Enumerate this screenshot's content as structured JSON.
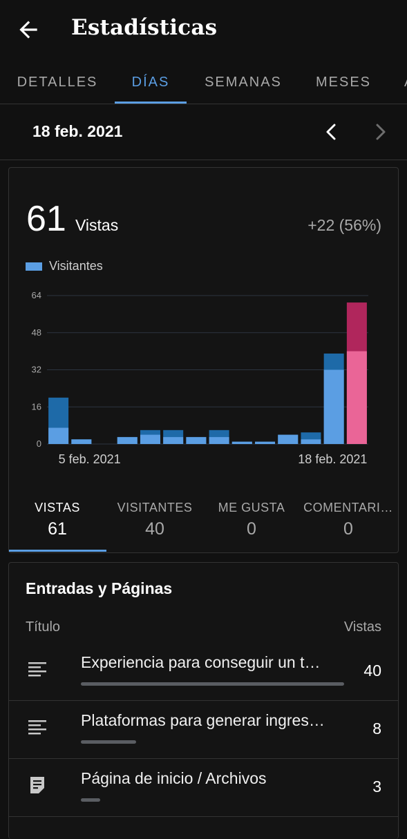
{
  "header": {
    "title": "Estadísticas",
    "back_icon": "arrow-back-icon"
  },
  "tabs": [
    {
      "label": "DETALLES",
      "active": false
    },
    {
      "label": "DÍAS",
      "active": true
    },
    {
      "label": "SEMANAS",
      "active": false
    },
    {
      "label": "MESES",
      "active": false
    },
    {
      "label": "A",
      "active": false
    }
  ],
  "date_nav": {
    "date": "18 feb. 2021"
  },
  "summary": {
    "count": "61",
    "label": "Vistas",
    "delta": "+22 (56%)",
    "legend": "Visitantes"
  },
  "chart_data": {
    "type": "bar",
    "x_labels": [
      "5 feb. 2021",
      "18 feb. 2021"
    ],
    "ylim": [
      0,
      64
    ],
    "yticks": [
      0,
      16,
      32,
      48,
      64
    ],
    "series": [
      {
        "name": "Vistas",
        "values": [
          20,
          2,
          0,
          3,
          6,
          6,
          3,
          6,
          1,
          1,
          4,
          5,
          39,
          61
        ]
      },
      {
        "name": "Visitantes",
        "values": [
          7,
          2,
          0,
          3,
          4,
          3,
          3,
          3,
          1,
          1,
          4,
          2,
          32,
          40
        ]
      }
    ],
    "colors": {
      "views": "#1e6aa8",
      "visitors": "#5b9ee3",
      "views_selected": "#b0265c",
      "visitors_selected": "#ea6597",
      "grid": "#2c3440",
      "tick": "#a9a9a9"
    },
    "selected_index": 13
  },
  "stat_tabs": [
    {
      "label": "VISTAS",
      "value": "61",
      "active": true
    },
    {
      "label": "VISITANTES",
      "value": "40",
      "active": false
    },
    {
      "label": "ME GUSTA",
      "value": "0",
      "active": false
    },
    {
      "label": "COMENTARI…",
      "value": "0",
      "active": false
    }
  ],
  "posts": {
    "title": "Entradas y Páginas",
    "col_title": "Título",
    "col_views": "Vistas",
    "items": [
      {
        "title": "Experiencia para conseguir un t…",
        "views": "40",
        "bar_fraction": 1.0,
        "icon": "post-lines-icon"
      },
      {
        "title": "Plataformas para generar ingres…",
        "views": "8",
        "bar_fraction": 0.2,
        "icon": "post-lines-icon"
      },
      {
        "title": "Página de inicio / Archivos",
        "views": "3",
        "bar_fraction": 0.075,
        "icon": "page-icon"
      }
    ]
  }
}
